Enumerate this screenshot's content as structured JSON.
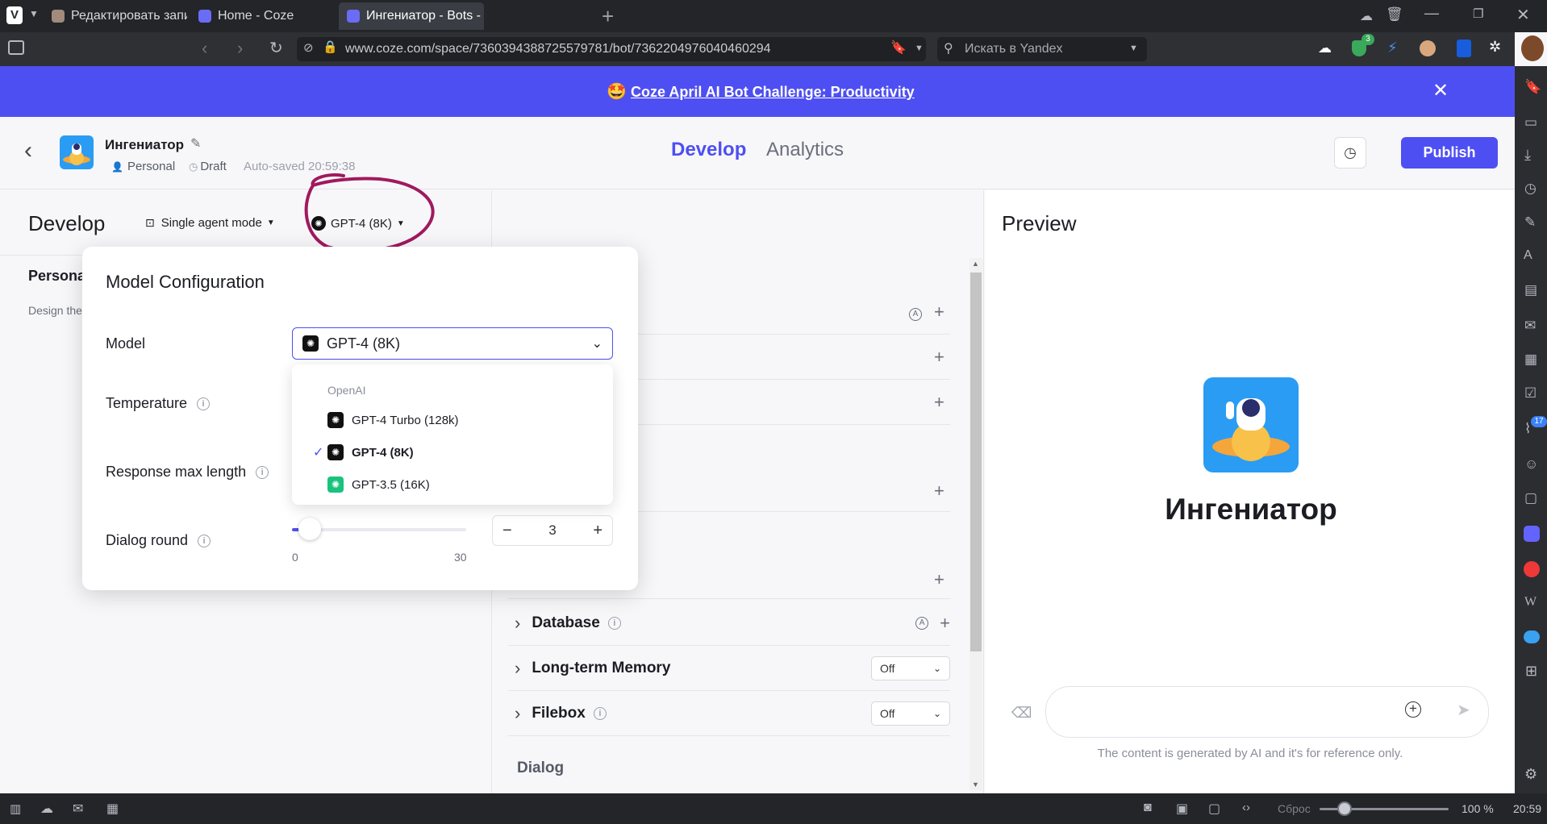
{
  "browser": {
    "tabs": [
      {
        "label": "Редактировать запись \"Ch"
      },
      {
        "label": "Home - Coze"
      },
      {
        "label": "Ингениатор - Bots - Coze"
      }
    ],
    "url": "www.coze.com/space/7360394388725579781/bot/7362204976040460294",
    "search_placeholder": "Искать в Yandex",
    "extension_badge": "3",
    "panel_badge": "17",
    "status": {
      "reset_label": "Сброс",
      "zoom": "100 %",
      "time": "20:59"
    }
  },
  "banner": {
    "emoji": "🤩",
    "text": "Coze April AI Bot Challenge: Productivity"
  },
  "header": {
    "bot_name": "Ингениатор",
    "workspace": "Personal",
    "state": "Draft",
    "autosave": "Auto-saved 20:59:38",
    "tabs": {
      "develop": "Develop",
      "analytics": "Analytics"
    },
    "publish": "Publish"
  },
  "develop": {
    "title": "Develop",
    "mode": "Single agent mode",
    "model": "GPT-4 (8K)",
    "persona_title": "Persona",
    "persona_hint": "Design the"
  },
  "popover": {
    "title": "Model Configuration",
    "model_label": "Model",
    "selected_model": "GPT-4 (8K)",
    "temperature_label": "Temperature",
    "response_label": "Response max length",
    "dialog_label": "Dialog round",
    "dialog_value": "3",
    "slider_min": "0",
    "slider_max": "30",
    "slider_fraction": 0.1,
    "dropdown_group": "OpenAI",
    "options": [
      {
        "label": "GPT-4 Turbo (128k)",
        "selected": false,
        "color": "#111111"
      },
      {
        "label": "GPT-4 (8K)",
        "selected": true,
        "color": "#111111"
      },
      {
        "label": "GPT-3.5 (16K)",
        "selected": false,
        "color": "#19c37d"
      }
    ]
  },
  "skills": {
    "database": "Database",
    "memory": "Long-term Memory",
    "memory_value": "Off",
    "filebox": "Filebox",
    "filebox_value": "Off",
    "dialog_section": "Dialog"
  },
  "preview": {
    "title": "Preview",
    "bot_name": "Ингениатор",
    "disclaimer": "The content is generated by AI and it's for reference only."
  },
  "colors": {
    "accent": "#4e4ff2",
    "annotation": "#a0195e"
  }
}
